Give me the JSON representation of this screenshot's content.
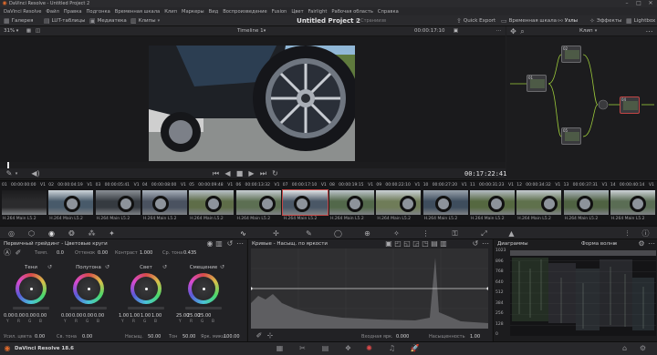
{
  "window": {
    "title": "DaVinci Resolve - Untitled Project 2"
  },
  "menu": [
    "DaVinci Resolve",
    "Файл",
    "Правка",
    "Подгонка",
    "Временная шкала",
    "Клип",
    "Маркеры",
    "Вид",
    "Воспроизведение",
    "Fusion",
    "Цвет",
    "Fairlight",
    "Рабочая область",
    "Справка"
  ],
  "toolbar": {
    "gallery": "Галерея",
    "lut": "LUT-таблицы",
    "media": "Медиатека",
    "clips": "Клипы",
    "project_title": "Untitled Project 2",
    "project_sub": "Є Страниизв",
    "quick_export": "Quick Export",
    "timeline": "Временная шкала",
    "nodes": "Узлы",
    "effects": "Эффекты",
    "lightbox": "Lightbox"
  },
  "viewer": {
    "zoom": "31%",
    "timeline_name": "Timeline 1",
    "timecode_top": "00:00:17:10",
    "timecode_main": "00:17:22:41"
  },
  "node_editor": {
    "label": "Клип",
    "nodes": [
      {
        "id": "01"
      },
      {
        "id": "02"
      },
      {
        "id": "03"
      },
      {
        "id": "04"
      },
      {
        "id": "05"
      }
    ]
  },
  "clips": [
    {
      "n": "01",
      "tc": "00:00:00:00",
      "track": "V1",
      "codec": "H.264 Main L5.2"
    },
    {
      "n": "02",
      "tc": "00:00:04:19",
      "track": "V1",
      "codec": "H.264 Main L5.2"
    },
    {
      "n": "03",
      "tc": "00:00:05:41",
      "track": "V1",
      "codec": "H.264 Main L5.2"
    },
    {
      "n": "04",
      "tc": "00:00:08:00",
      "track": "V1",
      "codec": "H.264 Main L5.2"
    },
    {
      "n": "05",
      "tc": "00:00:09:48",
      "track": "V1",
      "codec": "H.264 Main L5.2"
    },
    {
      "n": "06",
      "tc": "00:00:13:32",
      "track": "V1",
      "codec": "H.264 Main L5.2"
    },
    {
      "n": "07",
      "tc": "00:00:17:10",
      "track": "V1",
      "codec": "H.264 Main L5.2"
    },
    {
      "n": "08",
      "tc": "00:00:19:15",
      "track": "V1",
      "codec": "H.264 Main L5.2"
    },
    {
      "n": "09",
      "tc": "00:00:22:10",
      "track": "V1",
      "codec": "H.264 Main L5.2"
    },
    {
      "n": "10",
      "tc": "00:00:27:20",
      "track": "V1",
      "codec": "H.264 Main L5.2"
    },
    {
      "n": "11",
      "tc": "00:00:31:23",
      "track": "V1",
      "codec": "H.264 Main L5.2"
    },
    {
      "n": "12",
      "tc": "00:00:34:32",
      "track": "V1",
      "codec": "H.264 Main L5.2"
    },
    {
      "n": "13",
      "tc": "00:00:37:31",
      "track": "V1",
      "codec": "H.264 Main L5.2"
    },
    {
      "n": "14",
      "tc": "00:00:40:14",
      "track": "V1",
      "codec": "H.264 Main L5.2"
    }
  ],
  "wheels": {
    "title": "Первичный грейдинг - Цветовые круги",
    "temp_label": "Темп.",
    "temp_value": "0.0",
    "tint_label": "Оттенок",
    "tint_value": "0.00",
    "contrast_label": "Контраст",
    "contrast_value": "1.000",
    "pivot_label": "Ср. тона",
    "pivot_value": "0.435",
    "items": [
      {
        "name": "Тени",
        "values": [
          "0.00",
          "0.00",
          "0.00",
          "0.00"
        ]
      },
      {
        "name": "Полутона",
        "values": [
          "0.00",
          "0.00",
          "0.00",
          "0.00"
        ]
      },
      {
        "name": "Свет",
        "values": [
          "1.00",
          "1.00",
          "1.00",
          "1.00"
        ]
      },
      {
        "name": "Смещение",
        "values": [
          "25.00",
          "25.00",
          "25.00",
          ""
        ]
      }
    ],
    "channel_labels": [
      "Y",
      "R",
      "G",
      "B"
    ],
    "footer": {
      "boost_label": "Усил. цвета",
      "boost_value": "0.00",
      "shadow_label": "Св. тона",
      "shadow_value": "0.00",
      "sat_label": "Насыщ.",
      "sat_value": "50.00",
      "hue_label": "Тон",
      "hue_value": "50.00",
      "lum_label": "Ярк. микш.",
      "lum_value": "100.00"
    }
  },
  "curves": {
    "title": "Кривые - Насыщ. по яркости",
    "input_label": "Входная ярк.",
    "input_value": "0.000",
    "sat_label": "Насыщенность",
    "sat_value": "1.00"
  },
  "scopes": {
    "title": "Диаграммы",
    "mode": "Форма волны",
    "scale": [
      "1023",
      "896",
      "768",
      "640",
      "512",
      "384",
      "256",
      "128",
      "0"
    ]
  },
  "app": {
    "name": "DaVinci Resolve 18.6"
  }
}
